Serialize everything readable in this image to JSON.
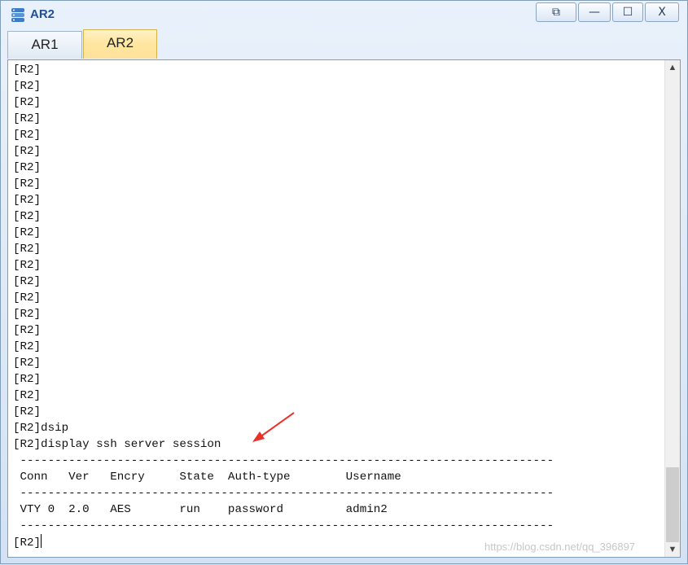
{
  "window": {
    "title": "AR2",
    "controls": {
      "restore": "⧉",
      "minimize": "—",
      "maximize": "☐",
      "close": "X"
    }
  },
  "tabs": [
    {
      "label": "AR1",
      "active": false
    },
    {
      "label": "AR2",
      "active": true
    }
  ],
  "terminal": {
    "prompt_lines": [
      "[R2]",
      "[R2]",
      "[R2]",
      "[R2]",
      "[R2]",
      "[R2]",
      "[R2]",
      "[R2]",
      "[R2]",
      "[R2]",
      "[R2]",
      "[R2]",
      "[R2]",
      "[R2]",
      "[R2]",
      "[R2]",
      "[R2]",
      "[R2]",
      "[R2]",
      "[R2]",
      "[R2]",
      "[R2]"
    ],
    "cmd1": "[R2]dsip",
    "cmd2": "[R2]display ssh server session",
    "separator": " -----------------------------------------------------------------------------",
    "table_header": " Conn   Ver   Encry     State  Auth-type        Username",
    "table_row": " VTY 0  2.0   AES       run    password         admin2",
    "final_prompt": "[R2]"
  },
  "watermark": "https://blog.csdn.net/qq_396897",
  "colors": {
    "accent": "#1f4f96",
    "active_tab": "#ffe7a1",
    "annotation_arrow": "#e8322a"
  }
}
